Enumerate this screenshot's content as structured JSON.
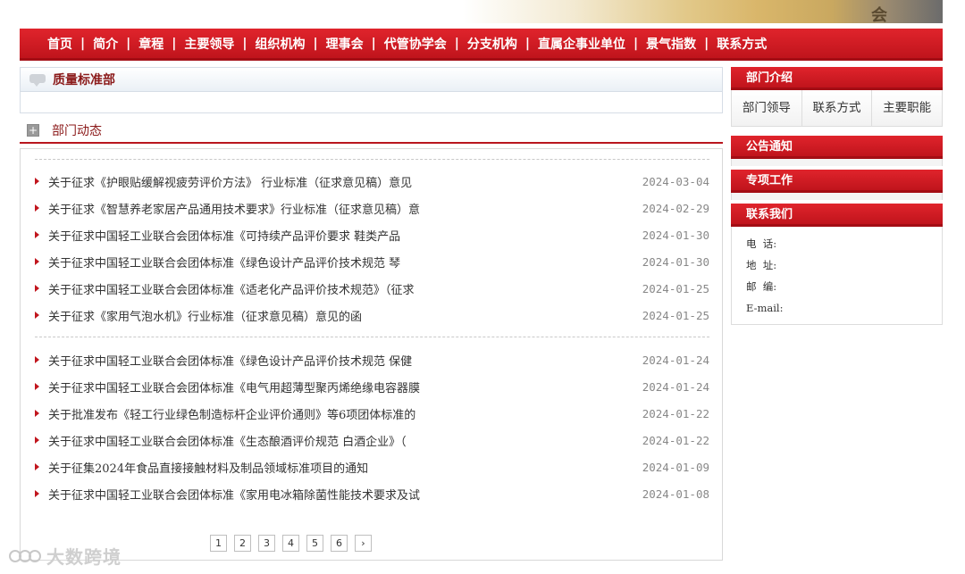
{
  "banner": {
    "char": "会"
  },
  "nav": {
    "items": [
      "首页",
      "简介",
      "章程",
      "主要领导",
      "组织机构",
      "理事会",
      "代管协学会",
      "分支机构",
      "直属企事业单位",
      "景气指数",
      "联系方式"
    ],
    "separator": "|"
  },
  "dept": {
    "title": "质量标准部"
  },
  "news": {
    "heading": "部门动态",
    "group1": [
      {
        "title": "关于征求《护眼贴缓解视疲劳评价方法》 行业标准（征求意见稿）意见",
        "date": "2024-03-04"
      },
      {
        "title": "关于征求《智慧养老家居产品通用技术要求》行业标准（征求意见稿）意",
        "date": "2024-02-29"
      },
      {
        "title": "关于征求中国轻工业联合会团体标准《可持续产品评价要求 鞋类产品",
        "date": "2024-01-30"
      },
      {
        "title": "关于征求中国轻工业联合会团体标准《绿色设计产品评价技术规范 琴",
        "date": "2024-01-30"
      },
      {
        "title": "关于征求中国轻工业联合会团体标准《适老化产品评价技术规范》（征求",
        "date": "2024-01-25"
      },
      {
        "title": "关于征求《家用气泡水机》行业标准（征求意见稿）意见的函",
        "date": "2024-01-25"
      }
    ],
    "group2": [
      {
        "title": "关于征求中国轻工业联合会团体标准《绿色设计产品评价技术规范 保健",
        "date": "2024-01-24"
      },
      {
        "title": "关于征求中国轻工业联合会团体标准《电气用超薄型聚丙烯绝缘电容器膜",
        "date": "2024-01-24"
      },
      {
        "title": "关于批准发布《轻工行业绿色制造标杆企业评价通则》等6项团体标准的",
        "date": "2024-01-22"
      },
      {
        "title": "关于征求中国轻工业联合会团体标准《生态酿酒评价规范 白酒企业》（",
        "date": "2024-01-22"
      },
      {
        "title": "关于征集2024年食品直接接触材料及制品领域标准项目的通知",
        "date": "2024-01-09"
      },
      {
        "title": "关于征求中国轻工业联合会团体标准《家用电冰箱除菌性能技术要求及试",
        "date": "2024-01-08"
      }
    ]
  },
  "pager": {
    "pages": [
      "1",
      "2",
      "3",
      "4",
      "5",
      "6"
    ],
    "next": "›"
  },
  "sidebar": {
    "intro": {
      "title": "部门介绍",
      "tabs": [
        "部门领导",
        "联系方式",
        "主要职能"
      ]
    },
    "notice": {
      "title": "公告通知"
    },
    "special": {
      "title": "专项工作"
    },
    "contact": {
      "title": "联系我们",
      "lines": [
        "电  话:",
        "地  址:",
        "邮  编:",
        "E-mail:"
      ]
    }
  },
  "watermark": {
    "text": "大数跨境"
  },
  "colors": {
    "brand_red": "#c8161e",
    "title_red": "#8b1a1a",
    "date_gray": "#888888"
  }
}
